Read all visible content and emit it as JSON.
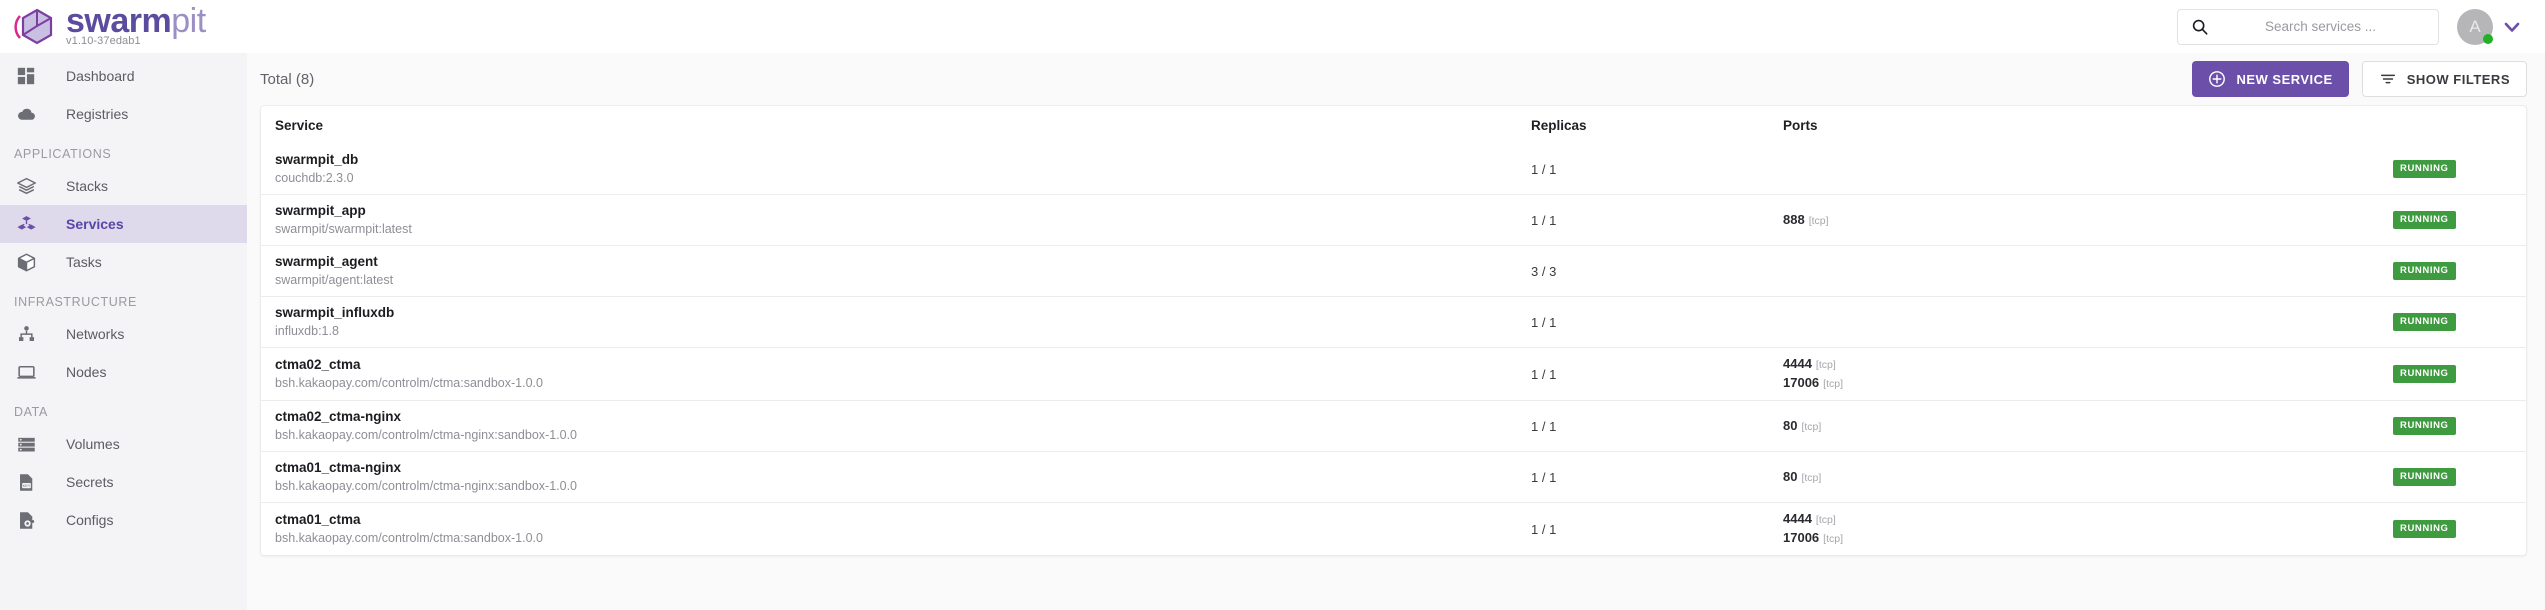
{
  "brand": {
    "name_bold": "swarm",
    "name_light": "pit",
    "version": "v1.10-37edab1",
    "logo_icon": "swarmpit-cube-icon",
    "accent": "#6b4fa8"
  },
  "topbar": {
    "search": {
      "icon": "search-icon",
      "placeholder": "Search services ...",
      "value": ""
    },
    "account": {
      "initial": "A",
      "status_dot": "online",
      "status_color": "#23b023",
      "chevron_icon": "chevron-down-icon"
    }
  },
  "sidebar": {
    "items": [
      {
        "label": "Dashboard",
        "icon": "dashboard-grid-icon",
        "active": false
      },
      {
        "label": "Registries",
        "icon": "cloud-icon",
        "active": false
      }
    ],
    "groups": [
      {
        "title": "APPLICATIONS",
        "items": [
          {
            "label": "Stacks",
            "icon": "layers-icon",
            "active": false
          },
          {
            "label": "Services",
            "icon": "services-icon",
            "active": true
          },
          {
            "label": "Tasks",
            "icon": "cube-icon",
            "active": false
          }
        ]
      },
      {
        "title": "INFRASTRUCTURE",
        "items": [
          {
            "label": "Networks",
            "icon": "network-nodes-icon",
            "active": false
          },
          {
            "label": "Nodes",
            "icon": "laptop-icon",
            "active": false
          }
        ]
      },
      {
        "title": "DATA",
        "items": [
          {
            "label": "Volumes",
            "icon": "volumes-icon",
            "active": false
          },
          {
            "label": "Secrets",
            "icon": "secret-key-icon",
            "active": false
          },
          {
            "label": "Configs",
            "icon": "config-gear-icon",
            "active": false
          }
        ]
      }
    ]
  },
  "main": {
    "total_label": "Total (8)",
    "new_service_button": "NEW SERVICE",
    "new_service_icon": "plus-circle-icon",
    "show_filters_button": "SHOW FILTERS",
    "show_filters_icon": "filter-icon",
    "table": {
      "columns": [
        "Service",
        "Replicas",
        "Ports",
        ""
      ],
      "rows": [
        {
          "name": "swarmpit_db",
          "image": "couchdb:2.3.0",
          "replicas": "1 / 1",
          "ports": [],
          "status": "RUNNING",
          "status_color": "#3f9b40"
        },
        {
          "name": "swarmpit_app",
          "image": "swarmpit/swarmpit:latest",
          "replicas": "1 / 1",
          "ports": [
            {
              "port": "888",
              "proto": "[tcp]"
            }
          ],
          "status": "RUNNING",
          "status_color": "#3f9b40"
        },
        {
          "name": "swarmpit_agent",
          "image": "swarmpit/agent:latest",
          "replicas": "3 / 3",
          "ports": [],
          "status": "RUNNING",
          "status_color": "#3f9b40"
        },
        {
          "name": "swarmpit_influxdb",
          "image": "influxdb:1.8",
          "replicas": "1 / 1",
          "ports": [],
          "status": "RUNNING",
          "status_color": "#3f9b40"
        },
        {
          "name": "ctma02_ctma",
          "image": "bsh.kakaopay.com/controlm/ctma:sandbox-1.0.0",
          "replicas": "1 / 1",
          "ports": [
            {
              "port": "4444",
              "proto": "[tcp]"
            },
            {
              "port": "17006",
              "proto": "[tcp]"
            }
          ],
          "status": "RUNNING",
          "status_color": "#3f9b40"
        },
        {
          "name": "ctma02_ctma-nginx",
          "image": "bsh.kakaopay.com/controlm/ctma-nginx:sandbox-1.0.0",
          "replicas": "1 / 1",
          "ports": [
            {
              "port": "80",
              "proto": "[tcp]"
            }
          ],
          "status": "RUNNING",
          "status_color": "#3f9b40"
        },
        {
          "name": "ctma01_ctma-nginx",
          "image": "bsh.kakaopay.com/controlm/ctma-nginx:sandbox-1.0.0",
          "replicas": "1 / 1",
          "ports": [
            {
              "port": "80",
              "proto": "[tcp]"
            }
          ],
          "status": "RUNNING",
          "status_color": "#3f9b40"
        },
        {
          "name": "ctma01_ctma",
          "image": "bsh.kakaopay.com/controlm/ctma:sandbox-1.0.0",
          "replicas": "1 / 1",
          "ports": [
            {
              "port": "4444",
              "proto": "[tcp]"
            },
            {
              "port": "17006",
              "proto": "[tcp]"
            }
          ],
          "status": "RUNNING",
          "status_color": "#3f9b40"
        }
      ]
    }
  }
}
